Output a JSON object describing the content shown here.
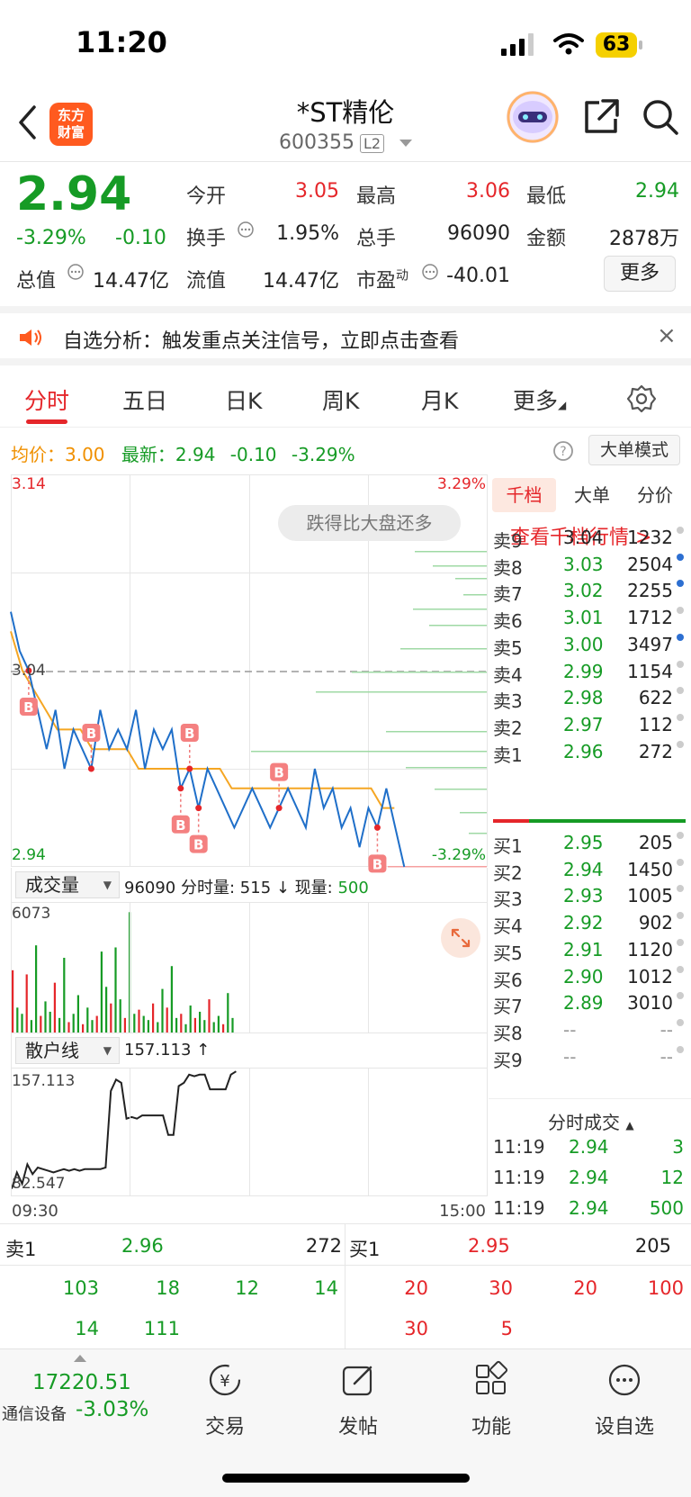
{
  "status_bar": {
    "time": "11:20",
    "battery": "63"
  },
  "header": {
    "logo_line1": "东方",
    "logo_line2": "财富",
    "stock_name": "*ST精伦",
    "stock_code": "600355",
    "level_badge": "L2"
  },
  "quote": {
    "price": "2.94",
    "change_pct": "-3.29%",
    "change_abs": "-0.10",
    "open_label": "今开",
    "open": "3.05",
    "high_label": "最高",
    "high": "3.06",
    "low_label": "最低",
    "low": "2.94",
    "turnover_label": "换手",
    "turnover": "1.95%",
    "volume_label": "总手",
    "volume": "96090",
    "amount_label": "金额",
    "amount": "2878万",
    "mktcap_label": "总值",
    "mktcap": "14.47亿",
    "float_label": "流值",
    "float_cap": "14.47亿",
    "pe_label": "市盈",
    "pe_sup": "动",
    "pe": "-40.01",
    "more_button": "更多"
  },
  "notice": {
    "text": "自选分析：触发重点关注信号，立即点击查看",
    "close": "×"
  },
  "tabs": [
    "分时",
    "五日",
    "日K",
    "周K",
    "月K",
    "更多"
  ],
  "chart_header": {
    "avg_label": "均价：",
    "avg": "3.00",
    "latest_label": "最新：",
    "latest": "2.94",
    "latest_change": "-0.10",
    "latest_pct": "-3.29%",
    "mode_button": "大单模式"
  },
  "chart_data": [
    {
      "type": "line",
      "y_top_label": "3.14",
      "y_mid_label": "3.04",
      "y_bottom_label": "2.94",
      "pct_top_label": "3.29%",
      "pct_bottom_label": "-3.29%",
      "tooltip": "跌得比大盘还多",
      "ylim": [
        2.94,
        3.14
      ],
      "series": [
        {
          "values": [
            3.07,
            3.05,
            3.04,
            3.02,
            3.0,
            3.02,
            2.99,
            3.01,
            3.0,
            2.99,
            3.02,
            3.0,
            3.01,
            3.0,
            3.02,
            2.99,
            3.01,
            3.0,
            3.01,
            2.98,
            2.99,
            2.97,
            2.99,
            2.98,
            2.97,
            2.96,
            2.97,
            2.98,
            2.97,
            2.96,
            2.97,
            2.98,
            2.97,
            2.96,
            2.99,
            2.97,
            2.98,
            2.96,
            2.97,
            2.95,
            2.97,
            2.96,
            2.98,
            2.96,
            2.94
          ]
        },
        {
          "values": [
            3.06,
            3.04,
            3.03,
            3.02,
            3.01,
            3.01,
            3.01,
            3.0,
            3.0,
            3.0,
            3.0,
            2.99,
            2.99,
            2.99,
            2.99,
            2.99,
            2.99,
            2.99,
            2.99,
            2.98,
            2.98,
            2.98,
            2.98,
            2.98,
            2.98,
            2.98,
            2.98,
            2.98,
            2.98,
            2.98,
            2.98,
            2.98,
            2.97,
            2.97
          ]
        }
      ],
      "b_markers": [
        "B",
        "B",
        "B",
        "B",
        "B",
        "B",
        "B"
      ]
    },
    {
      "type": "bar",
      "indicator_label": "成交量",
      "info_total": "96090",
      "info_text": "分时量: 515 ↓ 现量:",
      "info_current": "500",
      "y_max_label": "6073",
      "ylim": [
        0,
        6073
      ]
    },
    {
      "type": "line",
      "indicator_label": "散户线",
      "info_value": "157.113 ↑",
      "y_top_label": "157.113",
      "y_bottom_label": "82.547",
      "x_start": "09:30",
      "x_end": "15:00",
      "ylim": [
        82.547,
        157.113
      ],
      "series": [
        {
          "values": [
            85,
            95,
            88,
            100,
            94,
            98,
            97,
            96,
            95,
            96,
            97,
            96,
            97,
            96,
            97,
            97,
            97,
            97,
            98,
            145,
            152,
            150,
            128,
            129,
            128,
            130,
            130,
            130,
            130,
            130,
            118,
            118,
            148,
            150,
            155,
            154,
            155,
            155,
            146,
            146,
            146,
            146,
            155,
            157
          ]
        }
      ]
    }
  ],
  "order_book": {
    "tabs": [
      "千档",
      "大单",
      "分价"
    ],
    "link": "查看千档行情 >",
    "asks": [
      {
        "label": "卖9",
        "price": "3.04",
        "vol": "1232"
      },
      {
        "label": "卖8",
        "price": "3.03",
        "vol": "2504"
      },
      {
        "label": "卖7",
        "price": "3.02",
        "vol": "2255"
      },
      {
        "label": "卖6",
        "price": "3.01",
        "vol": "1712"
      },
      {
        "label": "卖5",
        "price": "3.00",
        "vol": "3497"
      },
      {
        "label": "卖4",
        "price": "2.99",
        "vol": "1154"
      },
      {
        "label": "卖3",
        "price": "2.98",
        "vol": "622"
      },
      {
        "label": "卖2",
        "price": "2.97",
        "vol": "112"
      },
      {
        "label": "卖1",
        "price": "2.96",
        "vol": "272"
      }
    ],
    "bids": [
      {
        "label": "买1",
        "price": "2.95",
        "vol": "205"
      },
      {
        "label": "买2",
        "price": "2.94",
        "vol": "1450"
      },
      {
        "label": "买3",
        "price": "2.93",
        "vol": "1005"
      },
      {
        "label": "买4",
        "price": "2.92",
        "vol": "902"
      },
      {
        "label": "买5",
        "price": "2.91",
        "vol": "1120"
      },
      {
        "label": "买6",
        "price": "2.90",
        "vol": "1012"
      },
      {
        "label": "买7",
        "price": "2.89",
        "vol": "3010"
      },
      {
        "label": "买8",
        "price": "--",
        "vol": "--"
      },
      {
        "label": "买9",
        "price": "--",
        "vol": "--"
      }
    ],
    "trades_title": "分时成交",
    "trades": [
      {
        "time": "11:19",
        "price": "2.94",
        "vol": "3"
      },
      {
        "time": "11:19",
        "price": "2.94",
        "vol": "12"
      },
      {
        "time": "11:19",
        "price": "2.94",
        "vol": "500"
      }
    ]
  },
  "queue": {
    "sell_label": "卖1",
    "sell_price": "2.96",
    "sell_total": "272",
    "buy_label": "买1",
    "buy_price": "2.95",
    "buy_total": "205",
    "sell_orders": [
      "103",
      "18",
      "12",
      "14",
      "14",
      "111"
    ],
    "buy_orders": [
      "20",
      "30",
      "20",
      "100",
      "30",
      "5"
    ]
  },
  "bottom_nav": {
    "index_value": "17220.51",
    "index_name": "通信设备",
    "index_pct": "-3.03%",
    "items": [
      "交易",
      "发帖",
      "功能",
      "设自选"
    ]
  }
}
